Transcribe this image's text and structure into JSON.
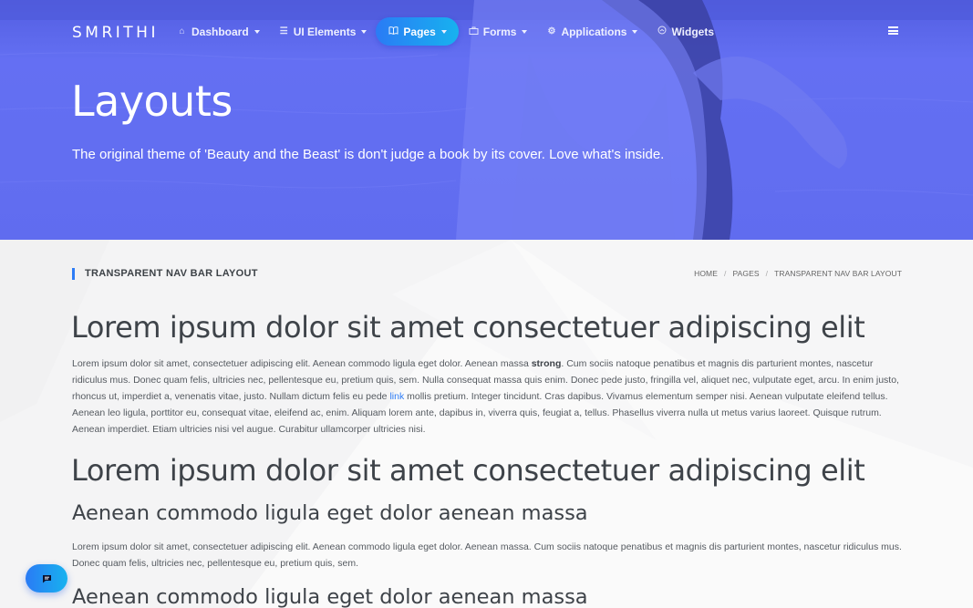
{
  "brand": "SMRITHI",
  "nav": [
    {
      "label": "Dashboard",
      "icon": "home-icon",
      "caret": true,
      "active": false
    },
    {
      "label": "UI Elements",
      "icon": "sliders-icon",
      "caret": true,
      "active": false
    },
    {
      "label": "Pages",
      "icon": "book-icon",
      "caret": true,
      "active": true
    },
    {
      "label": "Forms",
      "icon": "briefcase-icon",
      "caret": true,
      "active": false
    },
    {
      "label": "Applications",
      "icon": "gear-icon",
      "caret": true,
      "active": false
    },
    {
      "label": "Widgets",
      "icon": "gauge-icon",
      "caret": false,
      "active": false
    }
  ],
  "hero": {
    "title": "Layouts",
    "subtitle": "The original theme of 'Beauty and the Beast' is don't judge a book by its cover. Love what's inside."
  },
  "page_header": {
    "title": "TRANSPARENT NAV BAR LAYOUT",
    "breadcrumb": [
      "HOME",
      "PAGES",
      "TRANSPARENT NAV BAR LAYOUT"
    ]
  },
  "article": {
    "heading1": "Lorem ipsum dolor sit amet consectetuer adipiscing elit",
    "para1_before_strong": "Lorem ipsum dolor sit amet, consectetuer adipiscing elit. Aenean commodo ligula eget dolor. Aenean massa ",
    "para1_strong": "strong",
    "para1_middle": ". Cum sociis natoque penatibus et magnis dis parturient montes, nascetur ridiculus mus. Donec quam felis, ultricies nec, pellentesque eu, pretium quis, sem. Nulla consequat massa quis enim. Donec pede justo, fringilla vel, aliquet nec, vulputate eget, arcu. In enim justo, rhoncus ut, imperdiet a, venenatis vitae, justo. Nullam dictum felis eu pede ",
    "para1_link": "link",
    "para1_after_link": " mollis pretium. Integer tincidunt. Cras dapibus. Vivamus elementum semper nisi. Aenean vulputate eleifend tellus. Aenean leo ligula, porttitor eu, consequat vitae, eleifend ac, enim. Aliquam lorem ante, dapibus in, viverra quis, feugiat a, tellus. Phasellus viverra nulla ut metus varius laoreet. Quisque rutrum. Aenean imperdiet. Etiam ultricies nisi vel augue. Curabitur ullamcorper ultricies nisi.",
    "heading2": "Lorem ipsum dolor sit amet consectetuer adipiscing elit",
    "heading3": "Aenean commodo ligula eget dolor aenean massa",
    "para2": "Lorem ipsum dolor sit amet, consectetuer adipiscing elit. Aenean commodo ligula eget dolor. Aenean massa. Cum sociis natoque penatibus et magnis dis parturient montes, nascetur ridiculus mus. Donec quam felis, ultricies nec, pellentesque eu, pretium quis, sem.",
    "heading4": "Aenean commodo ligula eget dolor aenean massa"
  },
  "chat_button_icon": "chat-icon",
  "colors": {
    "accent": "#2d7cf6",
    "hero_overlay": "#5e6bf0",
    "active_gradient_end": "#17b2ef"
  }
}
